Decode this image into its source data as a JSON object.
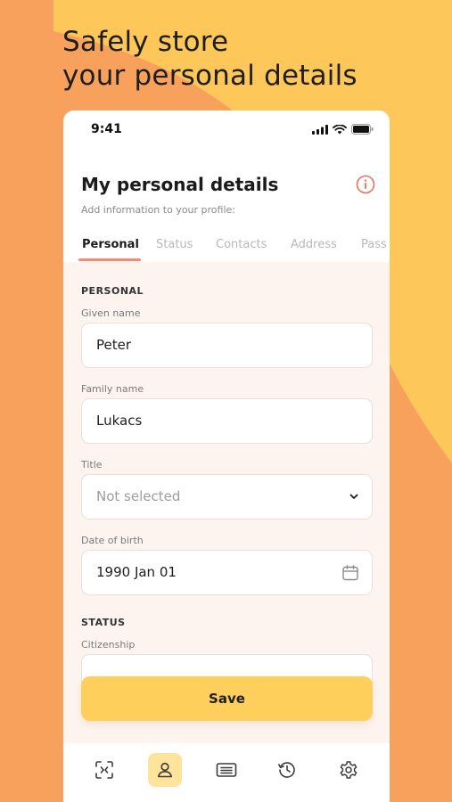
{
  "headline": {
    "line1": "Safely store",
    "line2": "your personal details"
  },
  "statusbar": {
    "time": "9:41"
  },
  "header": {
    "title": "My personal details",
    "subtitle": "Add information to your profile:"
  },
  "tabs": [
    {
      "label": "Personal",
      "active": true
    },
    {
      "label": "Status",
      "active": false
    },
    {
      "label": "Contacts",
      "active": false
    },
    {
      "label": "Address",
      "active": false
    },
    {
      "label": "Pass",
      "active": false
    }
  ],
  "form": {
    "personal_section": "PERSONAL",
    "given_name_label": "Given name",
    "given_name_value": "Peter",
    "family_name_label": "Family name",
    "family_name_value": "Lukacs",
    "title_label": "Title",
    "title_value": "Not selected",
    "dob_label": "Date of birth",
    "dob_value": "1990 Jan 01",
    "status_section": "STATUS",
    "citizenship_label": "Citizenship"
  },
  "actions": {
    "save_label": "Save"
  },
  "bottom_nav": [
    {
      "icon": "scan-icon",
      "active": false
    },
    {
      "icon": "person-icon",
      "active": true
    },
    {
      "icon": "card-icon",
      "active": false
    },
    {
      "icon": "history-icon",
      "active": false
    },
    {
      "icon": "settings-icon",
      "active": false
    }
  ],
  "colors": {
    "background_orange": "#f8a15c",
    "background_yellow": "#fdc75a",
    "accent_underline": "#f28b73",
    "button_yellow": "#ffcf5c",
    "form_background": "#fdf4f0"
  }
}
